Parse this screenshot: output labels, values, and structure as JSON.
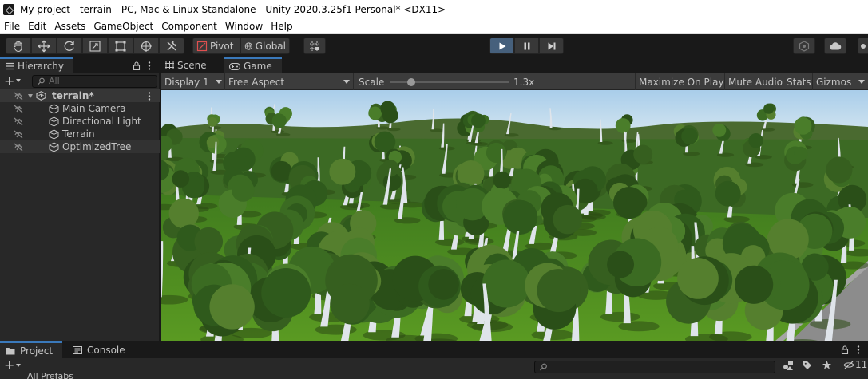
{
  "window": {
    "title": "My project - terrain - PC, Mac & Linux Standalone - Unity 2020.3.25f1 Personal* <DX11>"
  },
  "menu": [
    "File",
    "Edit",
    "Assets",
    "GameObject",
    "Component",
    "Window",
    "Help"
  ],
  "toolbar": {
    "pivot_label": "Pivot",
    "global_label": "Global",
    "play_active": true,
    "accent_color": "#46607c"
  },
  "hierarchy": {
    "tab_label": "Hierarchy",
    "search_placeholder": "All",
    "scene_name": "terrain*",
    "objects": [
      "Main Camera",
      "Directional Light",
      "Terrain",
      "OptimizedTree"
    ]
  },
  "view_tabs": {
    "scene_label": "Scene",
    "game_label": "Game"
  },
  "game_toolbar": {
    "display": "Display 1",
    "aspect": "Free Aspect",
    "scale_label": "Scale",
    "scale_value": "1.3x",
    "scale_fraction": 0.18,
    "maximize_label": "Maximize On Play",
    "mute_label": "Mute Audio",
    "stats_label": "Stats",
    "gizmos_label": "Gizmos"
  },
  "bottom": {
    "project_label": "Project",
    "console_label": "Console",
    "hidden_count": "11",
    "peek_text": "All Prefabs"
  }
}
